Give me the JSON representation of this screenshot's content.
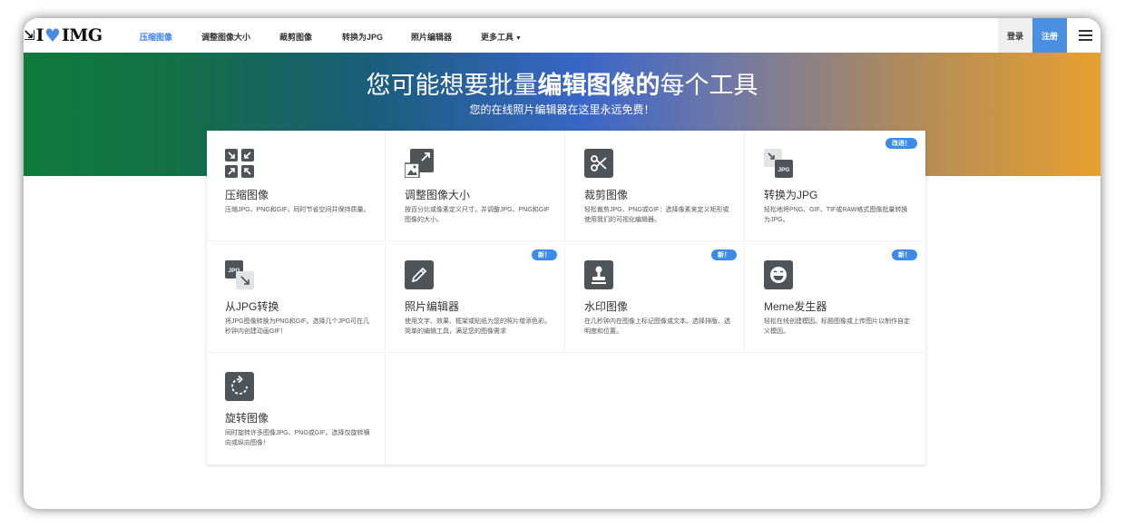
{
  "header": {
    "logo_left": "I",
    "logo_right": "IMG",
    "nav": [
      {
        "label": "压缩图像",
        "active": true
      },
      {
        "label": "调整图像大小",
        "active": false
      },
      {
        "label": "裁剪图像",
        "active": false
      },
      {
        "label": "转换为JPG",
        "active": false
      },
      {
        "label": "照片编辑器",
        "active": false
      },
      {
        "label": "更多工具",
        "active": false
      }
    ],
    "login_label": "登录",
    "signup_label": "注册"
  },
  "hero": {
    "title_part1": "您可能想要批量",
    "title_bold": "编辑图像的",
    "title_part2": "每个工具",
    "subtitle": "您的在线照片编辑器在这里永远免费！"
  },
  "tools": [
    {
      "title": "压缩图像",
      "desc": "压缩JPG、PNG和GIF，同时节省空间并保持质量。",
      "badge": "",
      "icon": "compress-icon"
    },
    {
      "title": "调整图像大小",
      "desc": "按百分比或像素定义尺寸，并调整JPG、PNG和GIF图像的大小。",
      "badge": "",
      "icon": "resize-icon"
    },
    {
      "title": "裁剪图像",
      "desc": "轻松裁剪JPG、PNG或GIF：选择像素来定义矩形或使用我们的可视化编辑器。",
      "badge": "",
      "icon": "scissors-icon"
    },
    {
      "title": "转换为JPG",
      "desc": "轻松地将PNG、GIF、TIF或RAW格式图像批量转换为JPG。",
      "badge": "改进！",
      "icon": "to-jpg-icon"
    },
    {
      "title": "从JPG转换",
      "desc": "将JPG图像转换为PNG和GIF。选择几个JPG可在几秒钟内创建动画GIF！",
      "badge": "",
      "icon": "from-jpg-icon"
    },
    {
      "title": "照片编辑器",
      "desc": "使用文字、效果、框架或贴纸为您的照片增添色彩。简单的编辑工具，满足您的图像需求",
      "badge": "新！",
      "icon": "pencil-icon"
    },
    {
      "title": "水印图像",
      "desc": "在几秒钟内在图像上标记图像或文本。选择排版、透明度和位置。",
      "badge": "新！",
      "icon": "stamp-icon"
    },
    {
      "title": "Meme发生器",
      "desc": "轻松在线创建模因。标题图像或上传图片以制作自定义模因。",
      "badge": "新！",
      "icon": "meme-icon"
    },
    {
      "title": "旋转图像",
      "desc": "同时旋转许多图像JPG、PNG或GIF。选择仅旋转横向或纵向图像！",
      "badge": "",
      "icon": "rotate-icon"
    }
  ],
  "colors": {
    "accent": "#4a90e2",
    "icon_bg": "#4f5459",
    "badge": "#3b8be8"
  }
}
